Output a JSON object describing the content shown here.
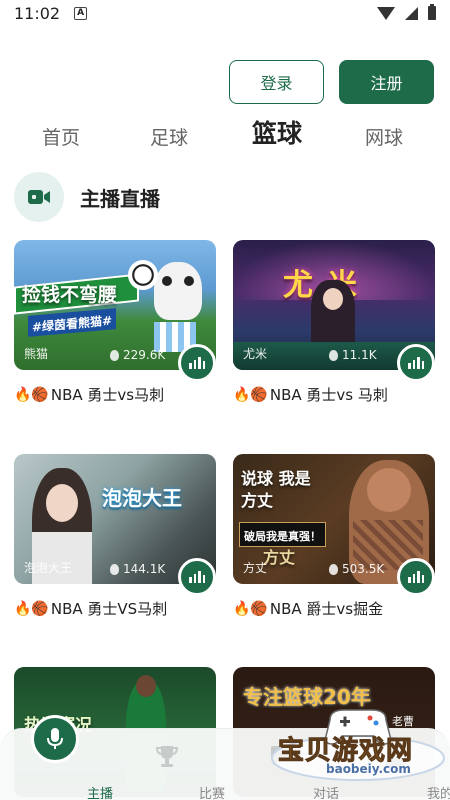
{
  "status_bar": {
    "time": "11:02",
    "notif_letter": "A"
  },
  "auth": {
    "login": "登录",
    "register": "注册"
  },
  "tabs": [
    {
      "label": "首页",
      "active": false
    },
    {
      "label": "足球",
      "active": false
    },
    {
      "label": "篮球",
      "active": true
    },
    {
      "label": "网球",
      "active": false
    }
  ],
  "section": {
    "title": "主播直播",
    "icon": "video-camera-icon"
  },
  "cards": [
    {
      "streamer": "熊猫",
      "views": "229.6K",
      "overlay_text": "捡钱不弯腰",
      "overlay_sub": "#绿茵看熊猫#",
      "title_emoji": "🔥🏀",
      "title": "NBA 勇士vs马刺"
    },
    {
      "streamer": "尤米",
      "views": "11.1K",
      "overlay_text": "尤米",
      "title_emoji": "🔥🏀",
      "title": "NBA 勇士vs 马刺"
    },
    {
      "streamer": "泡泡大王",
      "views": "144.1K",
      "overlay_text": "泡泡大王",
      "title_emoji": "🔥🏀",
      "title": "NBA 勇士VS马刺"
    },
    {
      "streamer": "方丈",
      "views": "503.5K",
      "overlay_text": "说球 我是方丈",
      "overlay_sub": "破局我是真强！",
      "overlay_sign": "方丈",
      "title_emoji": "🔥🏀",
      "title": "NBA  爵士vs掘金"
    },
    {
      "overlay_text": "热评赛况"
    },
    {
      "overlay_text": "专注篮球20年",
      "overlay_sub": "主播：老曹"
    }
  ],
  "bottom_nav": [
    {
      "label": "主播",
      "active": true,
      "icon": "microphone-icon"
    },
    {
      "label": "比赛",
      "active": false,
      "icon": "trophy-icon"
    },
    {
      "label": "对话",
      "active": false,
      "icon": "chat-icon"
    },
    {
      "label": "我的",
      "active": false,
      "icon": "user-icon"
    }
  ],
  "watermark": {
    "text": "宝贝游戏网",
    "url": "baobeiy.com"
  },
  "colors": {
    "accent": "#1e6b4a",
    "section_bg": "#e4f1ef"
  }
}
